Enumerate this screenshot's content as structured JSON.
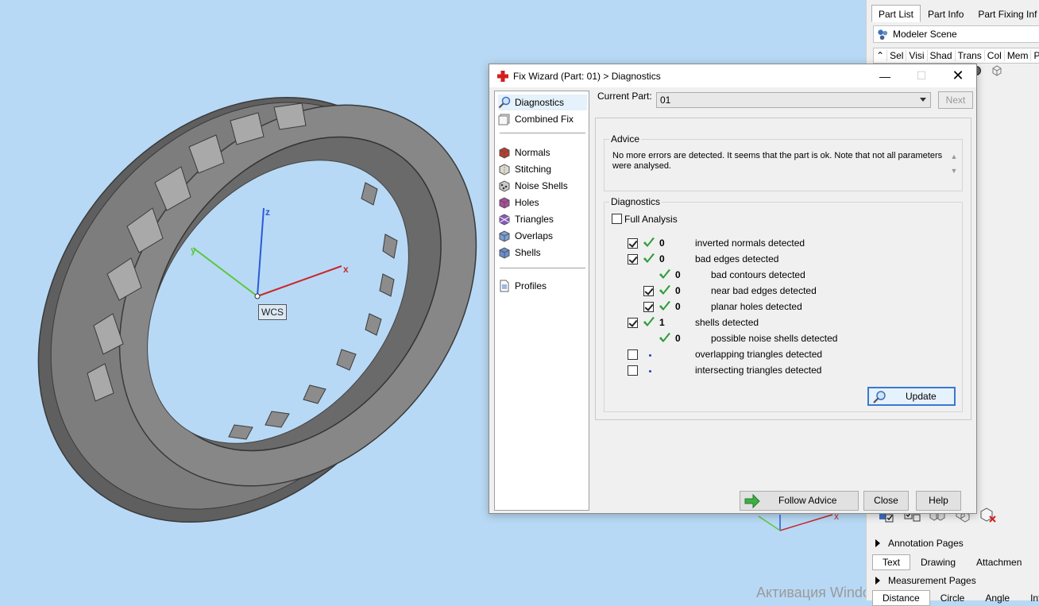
{
  "viewport": {
    "wcs_label": "WCS",
    "axis_x": "x",
    "axis_y": "y",
    "axis_z": "z",
    "watermark": "Активация Windows"
  },
  "right_panel": {
    "tabs": [
      "Part List",
      "Part Info",
      "Part Fixing Inf"
    ],
    "scene_label": "Modeler Scene",
    "columns": [
      "Sel",
      "Visi",
      "Shad",
      "Trans",
      "Col",
      "Mem",
      "P"
    ],
    "annotation_pages": "Annotation Pages",
    "annotation_tabs": [
      "Text",
      "Drawing",
      "Attachmen"
    ],
    "measurement_pages": "Measurement Pages",
    "measurement_tabs": [
      "Distance",
      "Circle",
      "Angle",
      "Info"
    ]
  },
  "dialog": {
    "title": "Fix Wizard (Part: 01) > Diagnostics",
    "nav": {
      "top": [
        {
          "label": "Diagnostics",
          "icon": "magnifier-icon"
        },
        {
          "label": "Combined Fix",
          "icon": "stack-icon"
        }
      ],
      "middle": [
        {
          "label": "Normals",
          "icon": "normals-cube-icon"
        },
        {
          "label": "Stitching",
          "icon": "stitching-cube-icon"
        },
        {
          "label": "Noise Shells",
          "icon": "noise-shells-icon"
        },
        {
          "label": "Holes",
          "icon": "holes-cube-icon"
        },
        {
          "label": "Triangles",
          "icon": "triangles-cube-icon"
        },
        {
          "label": "Overlaps",
          "icon": "overlaps-icon"
        },
        {
          "label": "Shells",
          "icon": "shells-icon"
        }
      ],
      "bottom": [
        {
          "label": "Profiles",
          "icon": "document-icon"
        }
      ]
    },
    "current_part_label": "Current Part:",
    "current_part_value": "01",
    "next_button": "Next",
    "advice_title": "Advice",
    "advice_text": "No more errors are detected. It seems that the part is ok. Note that not all parameters were analysed.",
    "diagnostics_title": "Diagnostics",
    "full_analysis_label": "Full Analysis",
    "rows": [
      {
        "checkbox": true,
        "checked": true,
        "ok": true,
        "value": "0",
        "label": "inverted normals detected",
        "indent": 0
      },
      {
        "checkbox": true,
        "checked": true,
        "ok": true,
        "value": "0",
        "label": "bad edges detected",
        "indent": 0
      },
      {
        "checkbox": false,
        "checked": false,
        "ok": true,
        "value": "0",
        "label": "bad contours detected",
        "indent": 1
      },
      {
        "checkbox": true,
        "checked": true,
        "ok": true,
        "value": "0",
        "label": "near bad edges detected",
        "indent": 1
      },
      {
        "checkbox": true,
        "checked": true,
        "ok": true,
        "value": "0",
        "label": "planar holes detected",
        "indent": 1
      },
      {
        "checkbox": true,
        "checked": true,
        "ok": true,
        "value": "1",
        "label": "shells detected",
        "indent": 0
      },
      {
        "checkbox": false,
        "checked": false,
        "ok": true,
        "value": "0",
        "label": "possible noise shells detected",
        "indent": 1
      },
      {
        "checkbox": true,
        "checked": false,
        "ok": false,
        "value": "",
        "label": "overlapping triangles detected",
        "indent": 0
      },
      {
        "checkbox": true,
        "checked": false,
        "ok": false,
        "value": "",
        "label": "intersecting triangles detected",
        "indent": 0
      }
    ],
    "update_button": "Update",
    "follow_advice_button": "Follow Advice",
    "close_button": "Close",
    "help_button": "Help"
  }
}
